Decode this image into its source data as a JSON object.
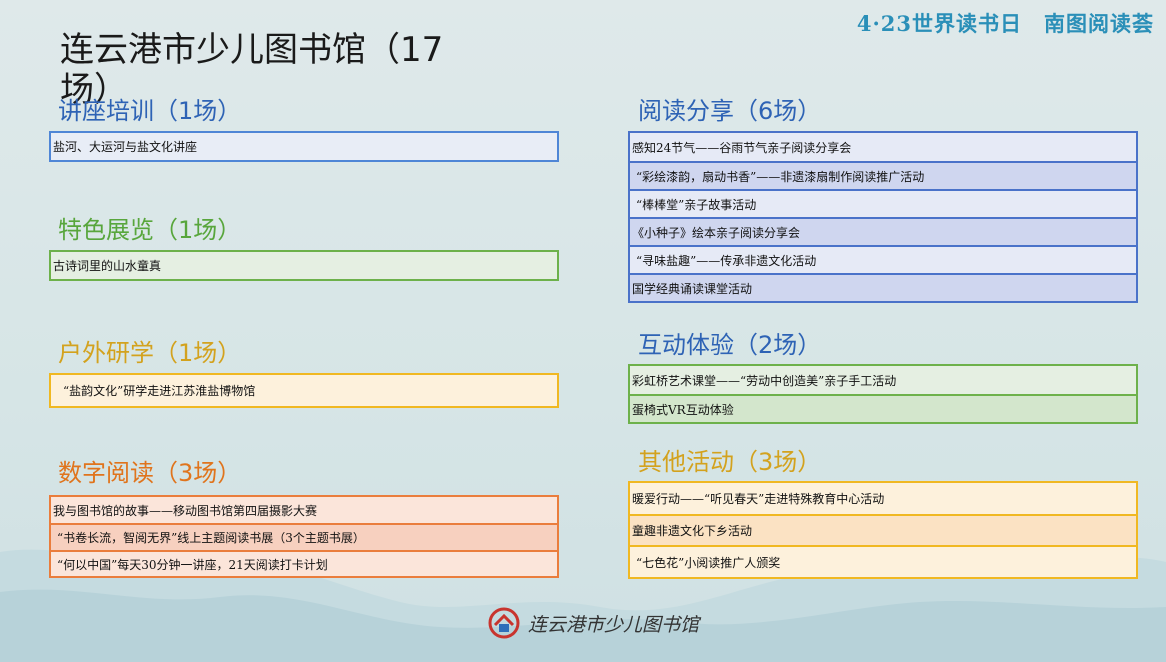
{
  "header_tag": {
    "part1": "4·23世界读书日",
    "part2": "南图阅读荟"
  },
  "main_title": "连云港市少儿图书馆（17场）",
  "sections": {
    "lecture": {
      "title": "讲座培训（1场）",
      "items": [
        "盐河、大运河与盐文化讲座"
      ]
    },
    "exhibit": {
      "title": "特色展览（1场）",
      "items": [
        "古诗词里的山水童真"
      ]
    },
    "outdoor": {
      "title": "户外研学（1场）",
      "items": [
        "“盐韵文化”研学走进江苏淮盐博物馆"
      ]
    },
    "digital": {
      "title": "数字阅读（3场）",
      "items": [
        "我与图书馆的故事——移动图书馆第四届摄影大赛",
        "“书卷长流，智阅无界”线上主题阅读书展（3个主题书展）",
        "“何以中国”每天30分钟一讲座，21天阅读打卡计划"
      ]
    },
    "reading": {
      "title": "阅读分享（6场）",
      "items": [
        "感知24节气——谷雨节气亲子阅读分享会",
        "“彩绘漆韵，扇动书香”——非遗漆扇制作阅读推广活动",
        "“棒棒堂”亲子故事活动",
        "《小种子》绘本亲子阅读分享会",
        "“寻味盐趣”——传承非遗文化活动",
        "国学经典诵读课堂活动"
      ]
    },
    "interactive": {
      "title": "互动体验（2场）",
      "items": [
        "彩虹桥艺术课堂——“劳动中创造美”亲子手工活动",
        "蛋椅式VR互动体验"
      ]
    },
    "other": {
      "title": "其他活动（3场）",
      "items": [
        "暖爱行动——“听见春天”走进特殊教育中心活动",
        "童趣非遗文化下乡活动",
        "“七色花”小阅读推广人颁奖"
      ]
    }
  },
  "footer": {
    "logo_text": "连云港市少儿图书馆",
    "logo_icon": "library-logo-icon"
  },
  "colors": {
    "blue": "#2e63b5",
    "green": "#58a63c",
    "gold": "#d3a21d",
    "orange": "#e0741c",
    "header": "#2a8fb8"
  }
}
